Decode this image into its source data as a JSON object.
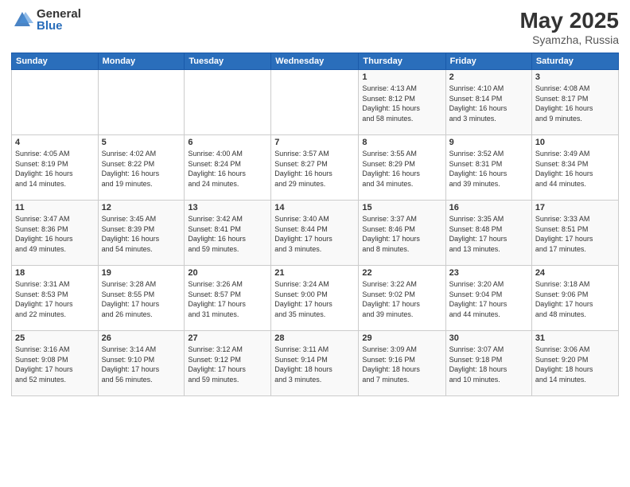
{
  "header": {
    "logo_general": "General",
    "logo_blue": "Blue",
    "title": "May 2025",
    "location": "Syamzha, Russia"
  },
  "days_of_week": [
    "Sunday",
    "Monday",
    "Tuesday",
    "Wednesday",
    "Thursday",
    "Friday",
    "Saturday"
  ],
  "weeks": [
    [
      {
        "day": "",
        "info": ""
      },
      {
        "day": "",
        "info": ""
      },
      {
        "day": "",
        "info": ""
      },
      {
        "day": "",
        "info": ""
      },
      {
        "day": "1",
        "info": "Sunrise: 4:13 AM\nSunset: 8:12 PM\nDaylight: 15 hours\nand 58 minutes."
      },
      {
        "day": "2",
        "info": "Sunrise: 4:10 AM\nSunset: 8:14 PM\nDaylight: 16 hours\nand 3 minutes."
      },
      {
        "day": "3",
        "info": "Sunrise: 4:08 AM\nSunset: 8:17 PM\nDaylight: 16 hours\nand 9 minutes."
      }
    ],
    [
      {
        "day": "4",
        "info": "Sunrise: 4:05 AM\nSunset: 8:19 PM\nDaylight: 16 hours\nand 14 minutes."
      },
      {
        "day": "5",
        "info": "Sunrise: 4:02 AM\nSunset: 8:22 PM\nDaylight: 16 hours\nand 19 minutes."
      },
      {
        "day": "6",
        "info": "Sunrise: 4:00 AM\nSunset: 8:24 PM\nDaylight: 16 hours\nand 24 minutes."
      },
      {
        "day": "7",
        "info": "Sunrise: 3:57 AM\nSunset: 8:27 PM\nDaylight: 16 hours\nand 29 minutes."
      },
      {
        "day": "8",
        "info": "Sunrise: 3:55 AM\nSunset: 8:29 PM\nDaylight: 16 hours\nand 34 minutes."
      },
      {
        "day": "9",
        "info": "Sunrise: 3:52 AM\nSunset: 8:31 PM\nDaylight: 16 hours\nand 39 minutes."
      },
      {
        "day": "10",
        "info": "Sunrise: 3:49 AM\nSunset: 8:34 PM\nDaylight: 16 hours\nand 44 minutes."
      }
    ],
    [
      {
        "day": "11",
        "info": "Sunrise: 3:47 AM\nSunset: 8:36 PM\nDaylight: 16 hours\nand 49 minutes."
      },
      {
        "day": "12",
        "info": "Sunrise: 3:45 AM\nSunset: 8:39 PM\nDaylight: 16 hours\nand 54 minutes."
      },
      {
        "day": "13",
        "info": "Sunrise: 3:42 AM\nSunset: 8:41 PM\nDaylight: 16 hours\nand 59 minutes."
      },
      {
        "day": "14",
        "info": "Sunrise: 3:40 AM\nSunset: 8:44 PM\nDaylight: 17 hours\nand 3 minutes."
      },
      {
        "day": "15",
        "info": "Sunrise: 3:37 AM\nSunset: 8:46 PM\nDaylight: 17 hours\nand 8 minutes."
      },
      {
        "day": "16",
        "info": "Sunrise: 3:35 AM\nSunset: 8:48 PM\nDaylight: 17 hours\nand 13 minutes."
      },
      {
        "day": "17",
        "info": "Sunrise: 3:33 AM\nSunset: 8:51 PM\nDaylight: 17 hours\nand 17 minutes."
      }
    ],
    [
      {
        "day": "18",
        "info": "Sunrise: 3:31 AM\nSunset: 8:53 PM\nDaylight: 17 hours\nand 22 minutes."
      },
      {
        "day": "19",
        "info": "Sunrise: 3:28 AM\nSunset: 8:55 PM\nDaylight: 17 hours\nand 26 minutes."
      },
      {
        "day": "20",
        "info": "Sunrise: 3:26 AM\nSunset: 8:57 PM\nDaylight: 17 hours\nand 31 minutes."
      },
      {
        "day": "21",
        "info": "Sunrise: 3:24 AM\nSunset: 9:00 PM\nDaylight: 17 hours\nand 35 minutes."
      },
      {
        "day": "22",
        "info": "Sunrise: 3:22 AM\nSunset: 9:02 PM\nDaylight: 17 hours\nand 39 minutes."
      },
      {
        "day": "23",
        "info": "Sunrise: 3:20 AM\nSunset: 9:04 PM\nDaylight: 17 hours\nand 44 minutes."
      },
      {
        "day": "24",
        "info": "Sunrise: 3:18 AM\nSunset: 9:06 PM\nDaylight: 17 hours\nand 48 minutes."
      }
    ],
    [
      {
        "day": "25",
        "info": "Sunrise: 3:16 AM\nSunset: 9:08 PM\nDaylight: 17 hours\nand 52 minutes."
      },
      {
        "day": "26",
        "info": "Sunrise: 3:14 AM\nSunset: 9:10 PM\nDaylight: 17 hours\nand 56 minutes."
      },
      {
        "day": "27",
        "info": "Sunrise: 3:12 AM\nSunset: 9:12 PM\nDaylight: 17 hours\nand 59 minutes."
      },
      {
        "day": "28",
        "info": "Sunrise: 3:11 AM\nSunset: 9:14 PM\nDaylight: 18 hours\nand 3 minutes."
      },
      {
        "day": "29",
        "info": "Sunrise: 3:09 AM\nSunset: 9:16 PM\nDaylight: 18 hours\nand 7 minutes."
      },
      {
        "day": "30",
        "info": "Sunrise: 3:07 AM\nSunset: 9:18 PM\nDaylight: 18 hours\nand 10 minutes."
      },
      {
        "day": "31",
        "info": "Sunrise: 3:06 AM\nSunset: 9:20 PM\nDaylight: 18 hours\nand 14 minutes."
      }
    ]
  ]
}
